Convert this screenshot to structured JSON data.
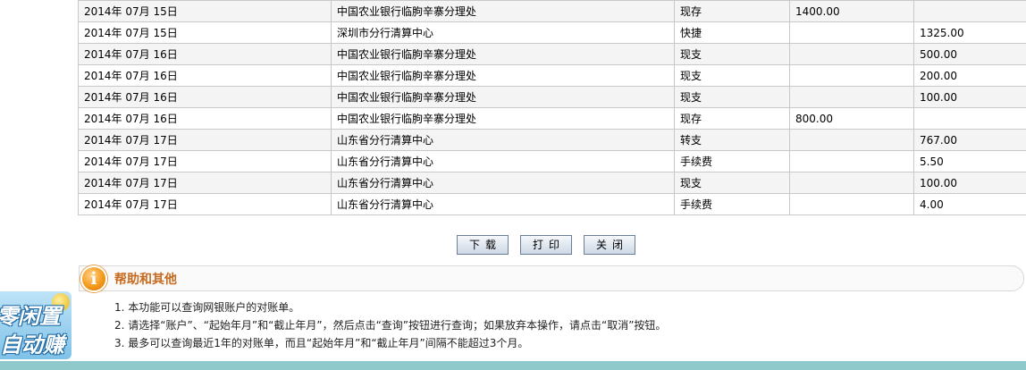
{
  "statement": {
    "rows": [
      {
        "date": "2014年  07月 15日",
        "branch": "中国农业银行临朐辛寨分理处",
        "summary": "现存",
        "income": "1400.00",
        "expense": ""
      },
      {
        "date": "2014年  07月 15日",
        "branch": "深圳市分行清算中心",
        "summary": "快捷",
        "income": "",
        "expense": "1325.00"
      },
      {
        "date": "2014年  07月 16日",
        "branch": "中国农业银行临朐辛寨分理处",
        "summary": "现支",
        "income": "",
        "expense": "500.00"
      },
      {
        "date": "2014年  07月 16日",
        "branch": "中国农业银行临朐辛寨分理处",
        "summary": "现支",
        "income": "",
        "expense": "200.00"
      },
      {
        "date": "2014年  07月 16日",
        "branch": "中国农业银行临朐辛寨分理处",
        "summary": "现支",
        "income": "",
        "expense": "100.00"
      },
      {
        "date": "2014年  07月 16日",
        "branch": "中国农业银行临朐辛寨分理处",
        "summary": "现存",
        "income": "800.00",
        "expense": ""
      },
      {
        "date": "2014年  07月 17日",
        "branch": "山东省分行清算中心",
        "summary": "转支",
        "income": "",
        "expense": "767.00"
      },
      {
        "date": "2014年  07月 17日",
        "branch": "山东省分行清算中心",
        "summary": "手续费",
        "income": "",
        "expense": "5.50"
      },
      {
        "date": "2014年  07月 17日",
        "branch": "山东省分行清算中心",
        "summary": "现支",
        "income": "",
        "expense": "100.00"
      },
      {
        "date": "2014年  07月 17日",
        "branch": "山东省分行清算中心",
        "summary": "手续费",
        "income": "",
        "expense": "4.00"
      }
    ]
  },
  "buttons": {
    "download": "下载",
    "print": "打印",
    "close": "关闭"
  },
  "help": {
    "icon": "i",
    "title": "帮助和其他",
    "items": [
      "1. 本功能可以查询网银账户的对账单。",
      "2. 请选择“账户”、“起始年月”和“截止年月”，然后点击“查询”按钮进行查询；如果放弃本操作，请点击“取消”按钮。",
      "3. 最多可以查询最近1年的对账单，而且“起始年月”和“截止年月”间隔不能超过3个月。"
    ]
  },
  "side_ad": {
    "line1": "零闲置",
    "line2": "自动赚"
  }
}
